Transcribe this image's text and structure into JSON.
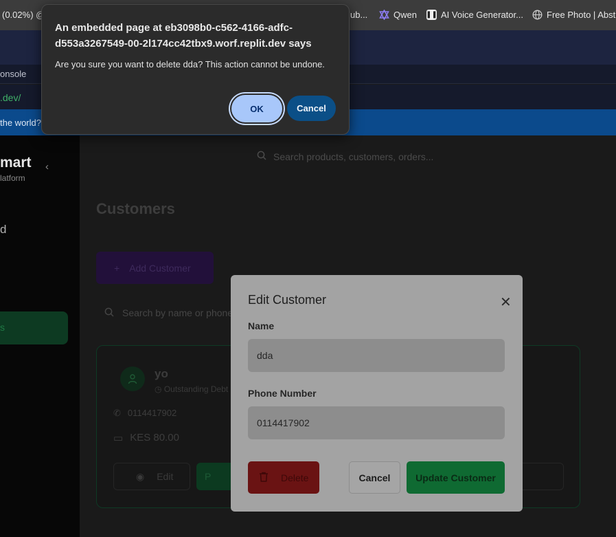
{
  "browser": {
    "bookmarks": [
      {
        "label": "(0.02%) @..."
      },
      {
        "label": "ub..."
      },
      {
        "label": "Qwen",
        "icon": "qwen-icon"
      },
      {
        "label": "AI Voice Generator...",
        "icon": "pause-icon"
      },
      {
        "label": "Free Photo | Abstra",
        "icon": "globe-icon"
      }
    ],
    "tab_label": "onsole",
    "url": ".dev/",
    "banner_text": "the world?"
  },
  "confirm_dialog": {
    "title": "An embedded page at eb3098b0-c562-4166-adfc-d553a3267549-00-2l174cc42tbx9.worf.replit.dev says",
    "message": "Are you sure you want to delete dda? This action cannot be undone.",
    "ok_label": "OK",
    "cancel_label": "Cancel"
  },
  "sidebar": {
    "brand": "mart",
    "subtitle": "latform",
    "item_d": "d",
    "active_item": "s"
  },
  "main": {
    "search_placeholder": "Search products, customers, orders...",
    "page_title": "Customers",
    "add_button_label": "Add Customer",
    "customer_search_placeholder": "Search by name or phone"
  },
  "customer_card": {
    "initial": "",
    "name": "yo",
    "status": "Outstanding Debt",
    "phone": "0114417902",
    "amount": "KES 80.00",
    "edit_label": "Edit",
    "pay_label": "P"
  },
  "edit_modal": {
    "title": "Edit Customer",
    "name_label": "Name",
    "name_value": "dda",
    "phone_label": "Phone Number",
    "phone_value": "0114417902",
    "delete_label": "Delete",
    "cancel_label": "Cancel",
    "update_label": "Update Customer"
  },
  "colors": {
    "ok_button": "#a8c7fa",
    "cancel_button": "#0b4f87",
    "delete_button": "#6a1313",
    "update_button": "#0f6a32"
  }
}
